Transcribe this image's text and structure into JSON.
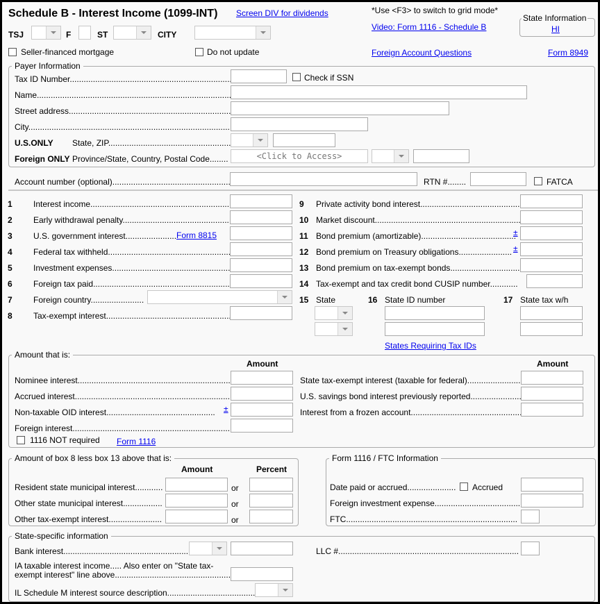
{
  "header": {
    "title": "Schedule B - Interest Income (1099-INT)",
    "screen_div_link": "Screen DIV for dividends",
    "grid_hint": "*Use <F3> to switch to grid mode*",
    "video_link": "Video: Form 1116 - Schedule B",
    "foreign_account_link": "Foreign Account Questions",
    "form_8949_link": "Form 8949",
    "state_info": {
      "title": "State Information",
      "state_link": "HI"
    },
    "tsj_label": "TSJ",
    "f_label": "F",
    "st_label": "ST",
    "city_label": "CITY",
    "seller_financed_label": "Seller-financed mortgage",
    "do_not_update_label": "Do not update"
  },
  "payer": {
    "group_title": "Payer Information",
    "tax_id_label": "Tax ID Number",
    "check_ssn_label": "Check if SSN",
    "name_label": "Name",
    "street_label": "Street address",
    "city_label": "City",
    "us_only_label": "U.S.ONLY",
    "state_zip_label": "State, ZIP",
    "foreign_only_label": "Foreign ONLY",
    "foreign_fields_label": "Province/State, Country, Postal Code",
    "click_to_access": "<Click to Access>",
    "account_label": "Account number (optional)",
    "rtn_label": "RTN #........",
    "fatca_label": "FATCA"
  },
  "boxes_left": [
    {
      "num": "1",
      "label": "Interest income"
    },
    {
      "num": "2",
      "label": "Early withdrawal penalty"
    },
    {
      "num": "3",
      "label": "U.S. government interest",
      "link": "Form 8815"
    },
    {
      "num": "4",
      "label": "Federal tax withheld"
    },
    {
      "num": "5",
      "label": "Investment expenses"
    },
    {
      "num": "6",
      "label": "Foreign tax paid"
    },
    {
      "num": "7",
      "label": "Foreign country"
    },
    {
      "num": "8",
      "label": "Tax-exempt interest"
    }
  ],
  "boxes_right": [
    {
      "num": "9",
      "label": "Private activity bond interest"
    },
    {
      "num": "10",
      "label": "Market discount"
    },
    {
      "num": "11",
      "label": "Bond premium (amortizable)",
      "pm": "±"
    },
    {
      "num": "12",
      "label": "Bond premium on Treasury obligations",
      "pm": "±"
    },
    {
      "num": "13",
      "label": "Bond premium on tax-exempt bonds"
    },
    {
      "num": "14",
      "label": "Tax-exempt and tax credit bond CUSIP number"
    }
  ],
  "state_boxes": {
    "box15_num": "15",
    "box15_label": "State",
    "box16_num": "16",
    "box16_label": "State ID number",
    "box17_num": "17",
    "box17_label": "State tax w/h",
    "states_link": "States Requiring Tax IDs"
  },
  "amount_that_is": {
    "group_title": "Amount that is:",
    "amount_header": "Amount",
    "left": [
      {
        "label": "Nominee interest"
      },
      {
        "label": "Accrued interest"
      },
      {
        "label": "Non-taxable OID interest",
        "pm": "±"
      },
      {
        "label": "Foreign interest"
      }
    ],
    "right": [
      {
        "label": "State tax-exempt interest (taxable for federal)"
      },
      {
        "label": "U.S. savings bond interest previously reported"
      },
      {
        "label": "Interest from a frozen account"
      }
    ],
    "not_required_label": "1116 NOT required",
    "form1116_link": "Form 1116"
  },
  "box8_less_13": {
    "group_title": "Amount of box 8 less box 13 above that is:",
    "amount_header": "Amount",
    "percent_header": "Percent",
    "or_label": "or",
    "rows": [
      {
        "label": "Resident state municipal interest"
      },
      {
        "label": "Other state municipal interest"
      },
      {
        "label": "Other tax-exempt interest"
      }
    ]
  },
  "ftc": {
    "group_title": "Form 1116 / FTC Information",
    "date_paid_label": "Date paid or accrued",
    "accrued_label": "Accrued",
    "foreign_expense_label": "Foreign investment expense",
    "ftc_label": "FTC"
  },
  "state_specific": {
    "group_title": "State-specific information",
    "bank_interest_label": "Bank interest",
    "ia_label_line1": "IA taxable interest income..... Also enter on \"State tax-",
    "ia_label_line2": "exempt interest\" line above",
    "il_label": "IL Schedule M interest source description",
    "llc_label": "LLC #"
  }
}
